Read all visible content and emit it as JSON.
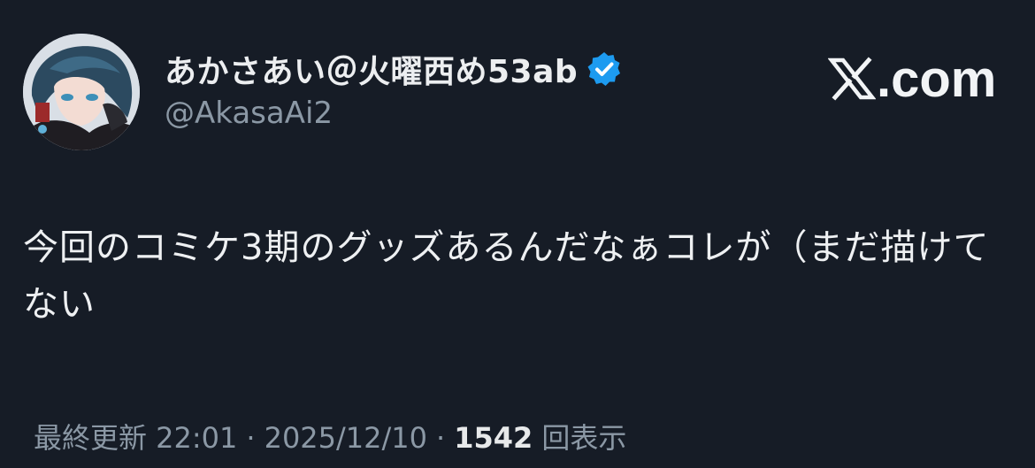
{
  "author": {
    "display_name": "あかさあい＠火曜西め53ab",
    "handle": "@AkasaAi2",
    "verified": true
  },
  "brand": {
    "site": ".com",
    "logo_icon": "x-logo-icon"
  },
  "tweet": {
    "text": "今回のコミケ3期のグッズあるんだなぁコレが（まだ描けてない"
  },
  "meta": {
    "last_updated": "最終更新 22:01",
    "separator1": "·",
    "date": "2025/12/10",
    "separator2": "·",
    "views": "1542",
    "views_label": "回表示"
  },
  "colors": {
    "background": "#161c26",
    "text": "#e7e9ea",
    "muted": "#8b98a5",
    "verified_badge": "#1d9bf0"
  }
}
